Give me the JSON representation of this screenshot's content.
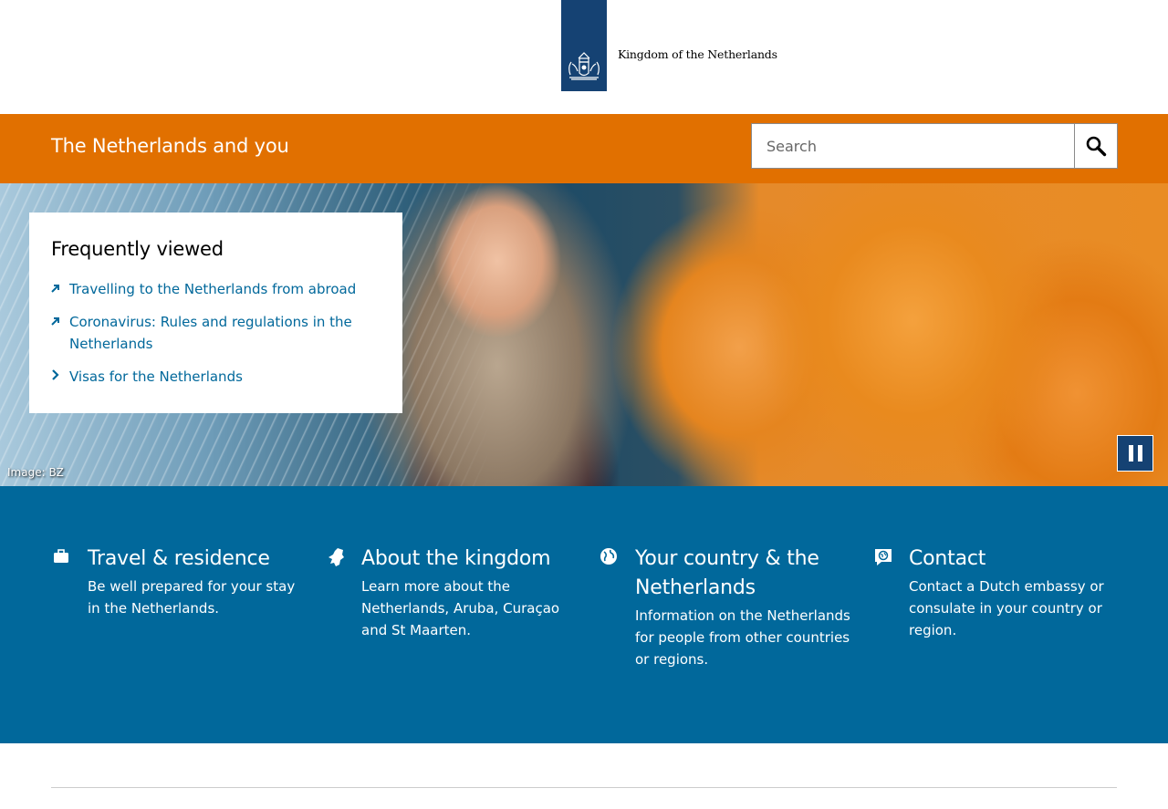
{
  "header": {
    "logo_text": "Kingdom of the Netherlands",
    "site_title": "The Netherlands and you"
  },
  "search": {
    "placeholder": "Search",
    "button_icon": "search-icon"
  },
  "hero": {
    "image_credit": "Image: BZ",
    "pause_icon": "pause-icon"
  },
  "frequently_viewed": {
    "title": "Frequently viewed",
    "items": [
      {
        "label": "Travelling to the Netherlands from abroad",
        "icon": "external-arrow-icon"
      },
      {
        "label": "Coronavirus: Rules and regulations in the Netherlands",
        "icon": "external-arrow-icon"
      },
      {
        "label": "Visas for the Netherlands",
        "icon": "chevron-right-icon"
      }
    ]
  },
  "sections": [
    {
      "title": "Travel & residence",
      "text": "Be well prepared for your stay in the Netherlands.",
      "icon": "briefcase-icon"
    },
    {
      "title": "About the kingdom",
      "text": "Learn more about the Netherlands, Aruba, Curaçao and St Maarten.",
      "icon": "netherlands-map-icon"
    },
    {
      "title": "Your country & the Netherlands",
      "text": "Information on the Netherlands for people from other countries or regions.",
      "icon": "globe-icon"
    },
    {
      "title": "Contact",
      "text": "Contact a Dutch embassy or consulate in your country or region.",
      "icon": "speech-globe-icon"
    }
  ],
  "colors": {
    "brand_blue": "#154273",
    "orange_bar": "#e17000",
    "link_blue": "#01689b",
    "section_blue": "#01689b"
  }
}
